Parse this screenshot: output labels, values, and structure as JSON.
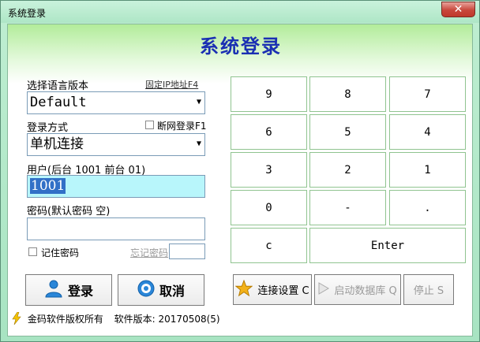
{
  "window": {
    "title": "系统登录",
    "close_label": "✕"
  },
  "header": {
    "title": "系统登录"
  },
  "language": {
    "label": "选择语言版本",
    "fixed_ip_link": "固定IP地址F4",
    "selected": "Default"
  },
  "login_mode": {
    "label": "登录方式",
    "offline_label": "断网登录F1",
    "offline_checked": false,
    "selected": "单机连接"
  },
  "user": {
    "label": "用户(后台 1001 前台 01)",
    "value": "1001"
  },
  "password": {
    "label": "密码(默认密码 空)",
    "value": "",
    "remember_label": "记住密码",
    "remember_checked": false,
    "forgot_label": "忘记密码",
    "forgot_value": ""
  },
  "buttons": {
    "login": "登录",
    "cancel": "取消",
    "connect_settings": "连接设置 C",
    "start_db": "启动数据库 Q",
    "stop": "停止 S"
  },
  "keypad": {
    "row1": [
      "9",
      "8",
      "7"
    ],
    "row2": [
      "6",
      "5",
      "4"
    ],
    "row3": [
      "3",
      "2",
      "1"
    ],
    "row4": [
      "0",
      "-",
      "."
    ],
    "clear": "c",
    "enter": "Enter"
  },
  "footer": {
    "copyright": "金码软件版权所有",
    "version": "软件版本: 20170508(5)"
  },
  "colors": {
    "title_blue": "#1a2fb3",
    "user_field_bg": "#b8f6fb",
    "key_border": "#90c490"
  }
}
